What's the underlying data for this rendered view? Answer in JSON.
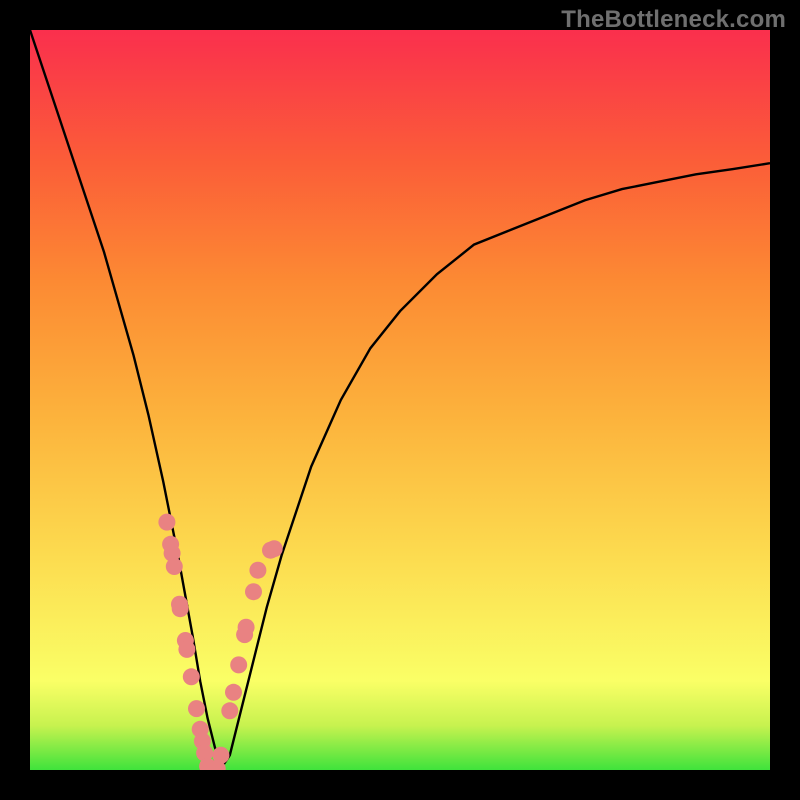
{
  "watermark": "TheBottleneck.com",
  "colors": {
    "gradient_bottom": "#3fe33c",
    "gradient_top": "#fa2f4d",
    "curve": "#000000",
    "dots": "#e98282",
    "frame": "#000000"
  },
  "chart_data": {
    "type": "line",
    "title": "",
    "xlabel": "",
    "ylabel": "",
    "xlim": [
      0,
      100
    ],
    "ylim": [
      0,
      100
    ],
    "x": [
      0,
      2,
      4,
      6,
      8,
      10,
      12,
      14,
      16,
      18,
      20,
      22,
      23,
      24,
      25,
      26,
      27,
      28,
      30,
      32,
      34,
      38,
      42,
      46,
      50,
      55,
      60,
      65,
      70,
      75,
      80,
      85,
      90,
      95,
      100
    ],
    "y": [
      100,
      94,
      88,
      82,
      76,
      70,
      63,
      56,
      48,
      39,
      29,
      18,
      12,
      7,
      3,
      0.5,
      2,
      6,
      14,
      22,
      29,
      41,
      50,
      57,
      62,
      67,
      71,
      73,
      75,
      77,
      78.5,
      79.5,
      80.5,
      81.2,
      82
    ],
    "markers": {
      "x": [
        18.5,
        19,
        19.2,
        19.5,
        20.2,
        20.3,
        21,
        21.2,
        21.8,
        22.5,
        23,
        23.3,
        23.6,
        24,
        24.3,
        25,
        25.3,
        25.8,
        27,
        27.5,
        28.2,
        29,
        29.2,
        30.2,
        30.8,
        32.5,
        33
      ],
      "y": [
        33.5,
        30.5,
        29.3,
        27.5,
        22.4,
        21.8,
        17.5,
        16.3,
        12.6,
        8.3,
        5.5,
        3.9,
        2.3,
        0.5,
        0.2,
        0.1,
        0.2,
        2,
        8,
        10.5,
        14.2,
        18.3,
        19.3,
        24.1,
        27,
        29.7,
        29.9
      ]
    }
  }
}
